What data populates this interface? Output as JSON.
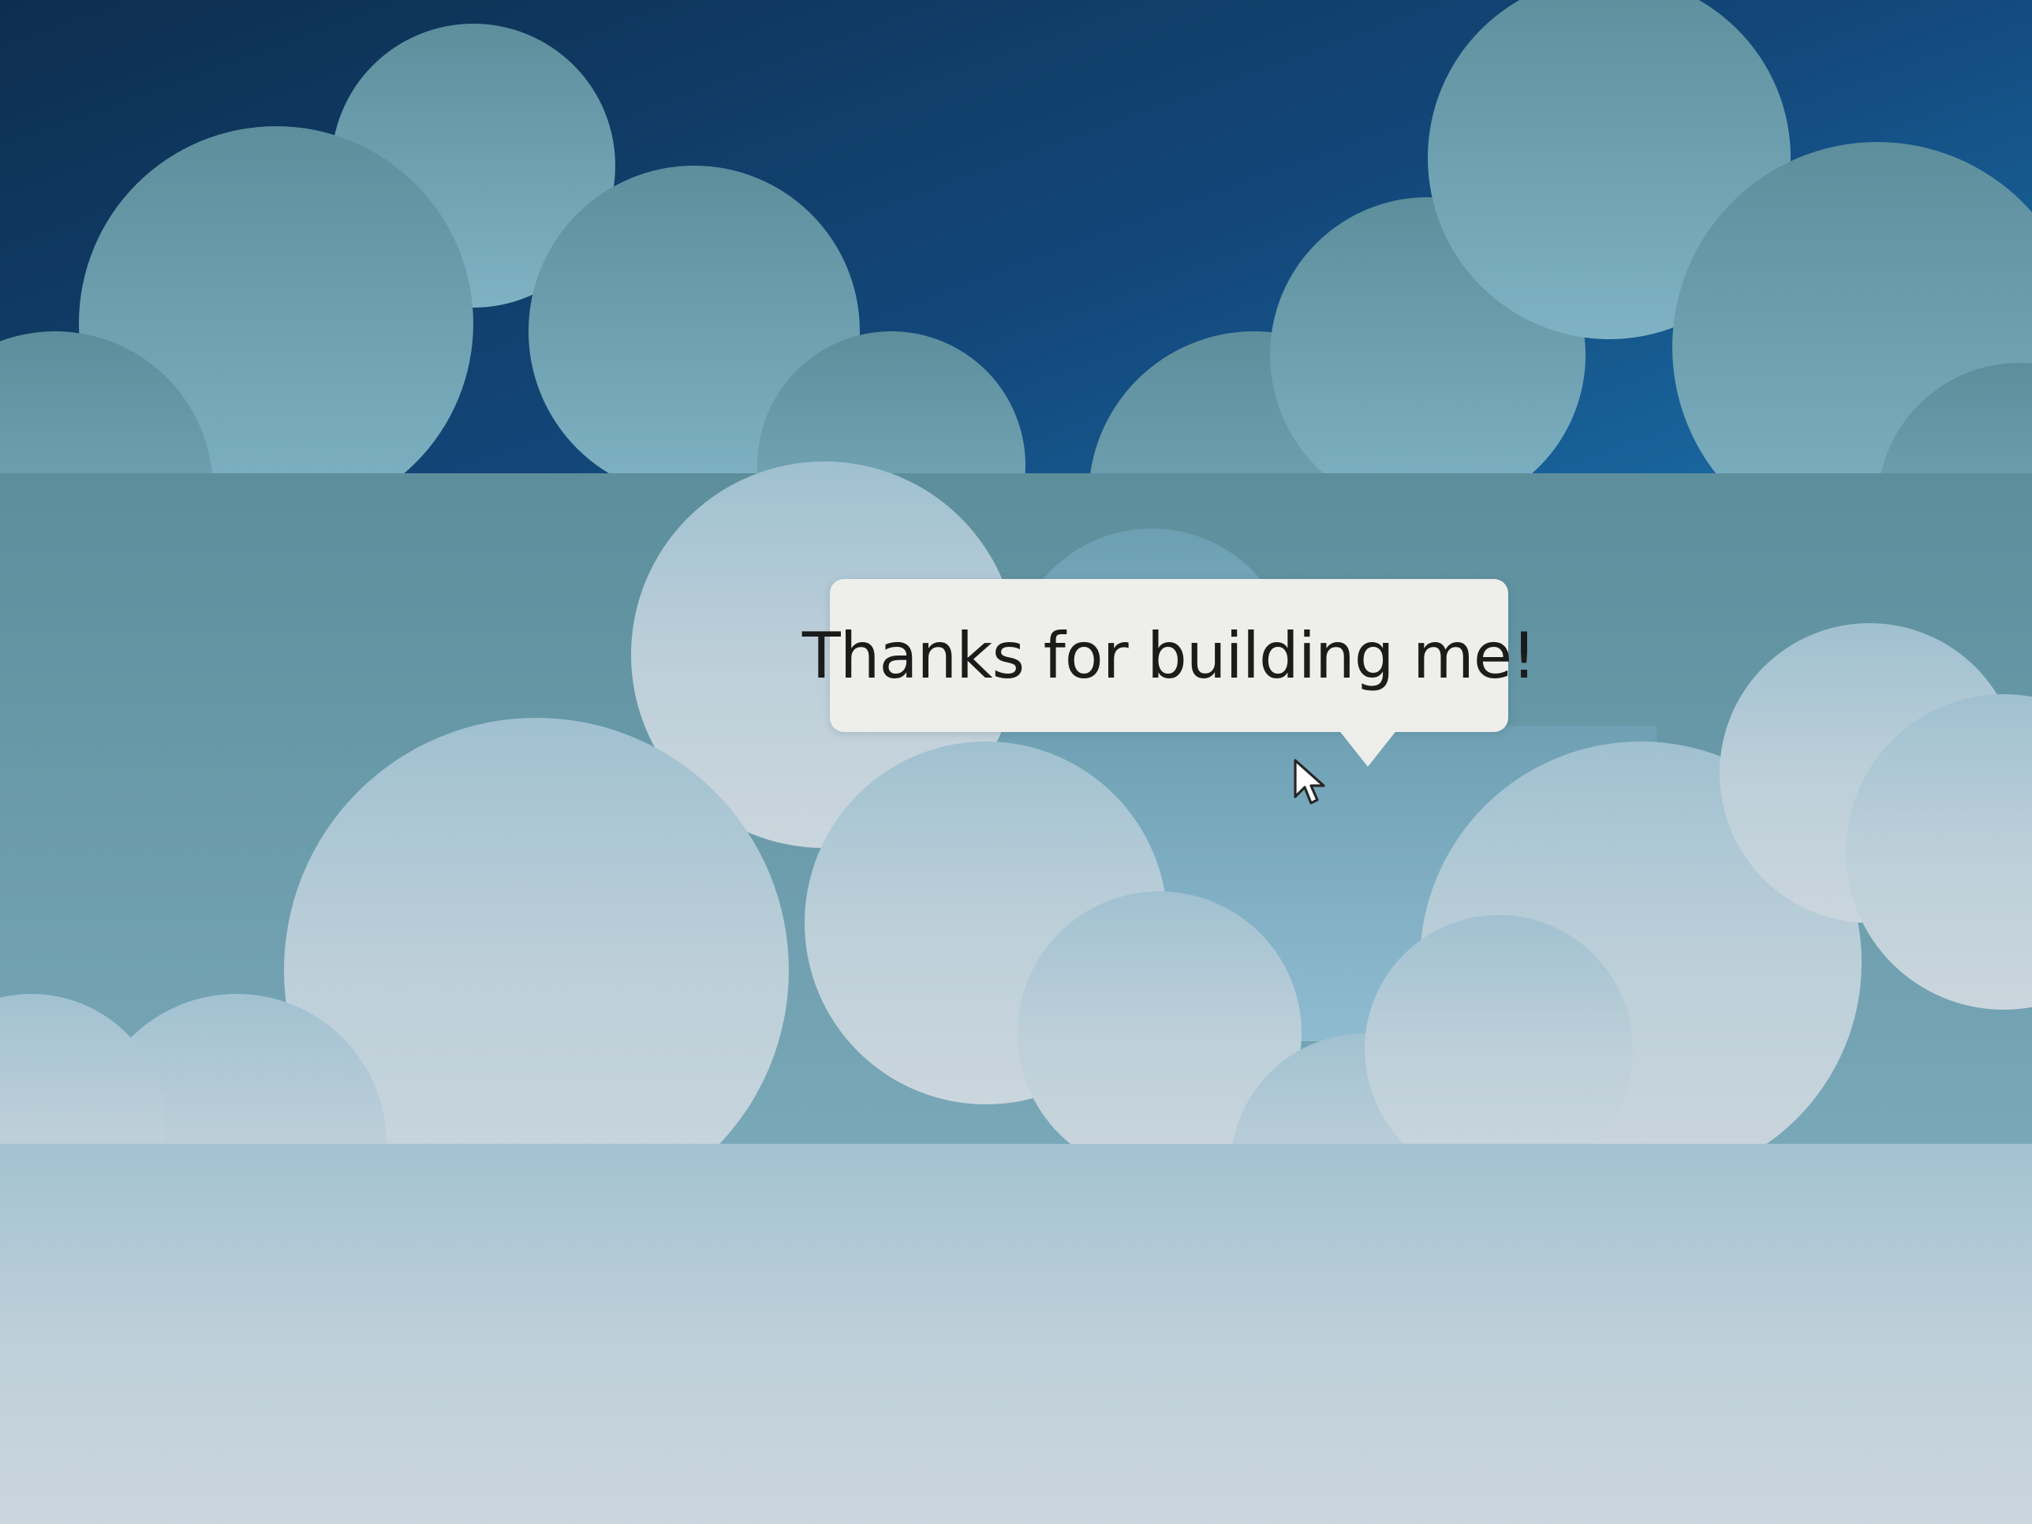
{
  "scene": {
    "background_name": "sky-with-clouds",
    "colors": {
      "sky_dark": "#0d2e4f",
      "sky_mid": "#1a6fa8",
      "cloud_back": "#6e9fae",
      "cloud_front": "#c4d3dc",
      "tooltip_bg": "#eeeeea",
      "tooltip_text": "#1a1a1a"
    }
  },
  "tooltip": {
    "message": "Thanks for building me!"
  },
  "cursor": {
    "icon": "arrow-pointer-icon"
  }
}
